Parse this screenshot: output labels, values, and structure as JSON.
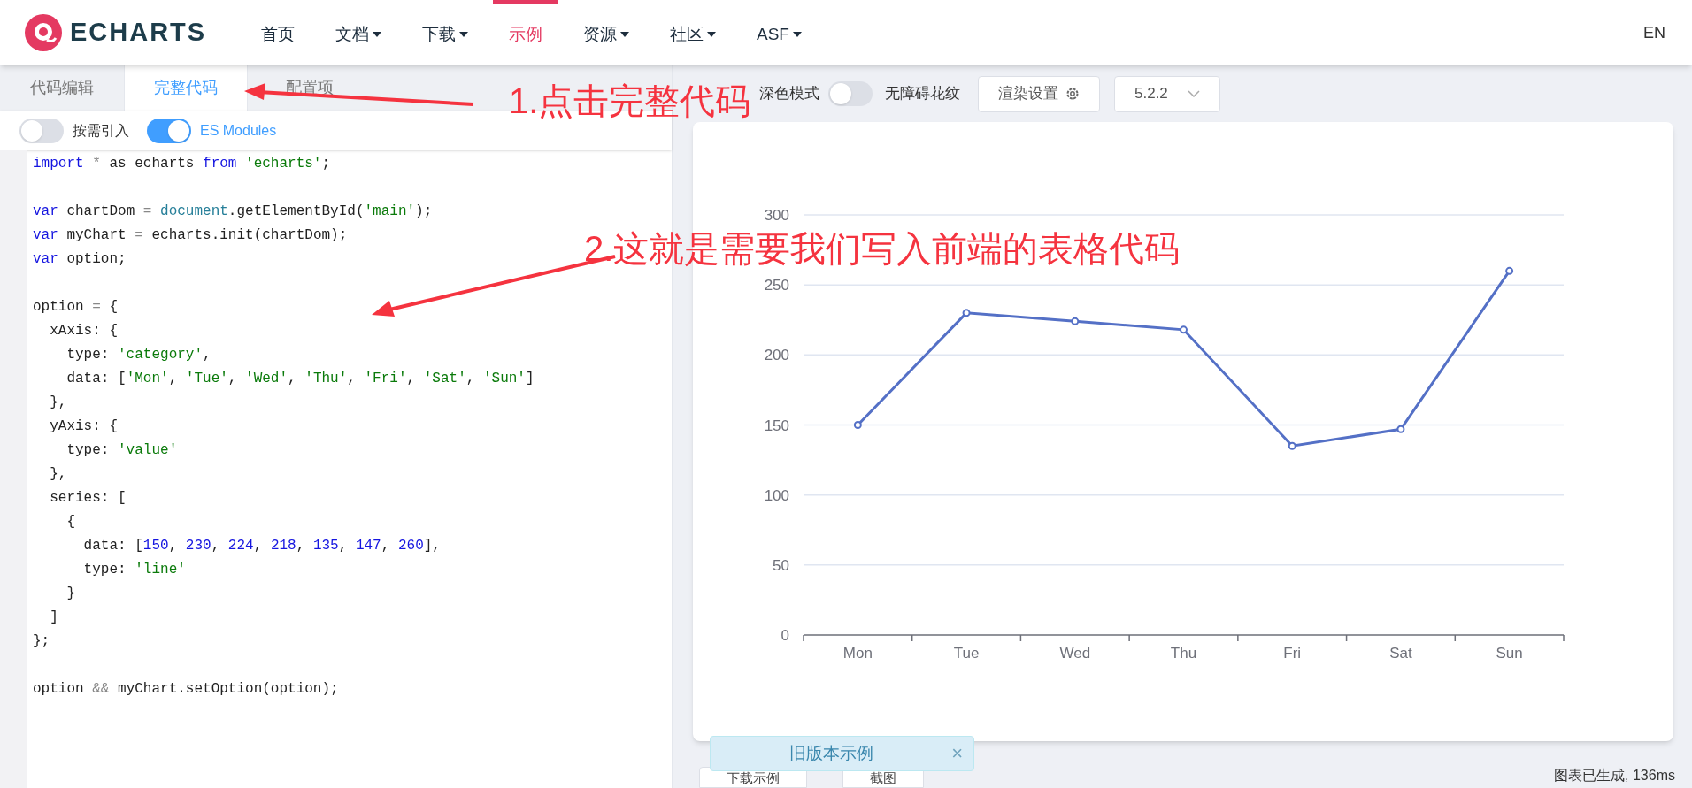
{
  "header": {
    "logo_text": "ECHARTS",
    "nav": [
      {
        "label": "首页",
        "has_menu": false,
        "selected": false
      },
      {
        "label": "文档",
        "has_menu": true,
        "selected": false
      },
      {
        "label": "下载",
        "has_menu": true,
        "selected": false
      },
      {
        "label": "示例",
        "has_menu": false,
        "selected": true
      },
      {
        "label": "资源",
        "has_menu": true,
        "selected": false
      },
      {
        "label": "社区",
        "has_menu": true,
        "selected": false
      },
      {
        "label": "ASF",
        "has_menu": true,
        "selected": false
      }
    ],
    "language": "EN"
  },
  "editor": {
    "tabs": [
      {
        "label": "代码编辑",
        "selected": false
      },
      {
        "label": "完整代码",
        "selected": true
      },
      {
        "label": "配置项",
        "selected": false
      }
    ],
    "toggles": [
      {
        "label": "按需引入",
        "on": false
      },
      {
        "label": "ES Modules",
        "on": true
      }
    ],
    "code_lines": [
      {
        "kind": "code",
        "tokens": [
          {
            "kind": "keyword",
            "text": "import"
          },
          {
            "kind": "operator",
            "text": " * "
          },
          {
            "kind": "plain",
            "text": "as echarts "
          },
          {
            "kind": "keyword",
            "text": "from"
          },
          {
            "kind": "string",
            "text": " 'echarts'"
          },
          {
            "kind": "plain",
            "text": ";"
          }
        ]
      },
      {
        "kind": "blank"
      },
      {
        "kind": "code",
        "tokens": [
          {
            "kind": "keyword",
            "text": "var"
          },
          {
            "kind": "plain",
            "text": " chartDom "
          },
          {
            "kind": "operator",
            "text": "="
          },
          {
            "kind": "builtin",
            "text": " document"
          },
          {
            "kind": "plain",
            "text": ".getElementById("
          },
          {
            "kind": "string",
            "text": "'main'"
          },
          {
            "kind": "plain",
            "text": ");"
          }
        ]
      },
      {
        "kind": "code",
        "tokens": [
          {
            "kind": "keyword",
            "text": "var"
          },
          {
            "kind": "plain",
            "text": " myChart "
          },
          {
            "kind": "operator",
            "text": "="
          },
          {
            "kind": "plain",
            "text": " echarts.init(chartDom);"
          }
        ]
      },
      {
        "kind": "code",
        "tokens": [
          {
            "kind": "keyword",
            "text": "var"
          },
          {
            "kind": "plain",
            "text": " option;"
          }
        ]
      },
      {
        "kind": "blank"
      },
      {
        "kind": "code",
        "tokens": [
          {
            "kind": "plain",
            "text": "option "
          },
          {
            "kind": "operator",
            "text": "="
          },
          {
            "kind": "plain",
            "text": " {"
          }
        ]
      },
      {
        "kind": "code",
        "tokens": [
          {
            "kind": "plain",
            "text": "  xAxis: {"
          }
        ]
      },
      {
        "kind": "code",
        "tokens": [
          {
            "kind": "plain",
            "text": "    type: "
          },
          {
            "kind": "string",
            "text": "'category'"
          },
          {
            "kind": "plain",
            "text": ","
          }
        ]
      },
      {
        "kind": "code",
        "tokens": [
          {
            "kind": "plain",
            "text": "    data: ["
          },
          {
            "kind": "string",
            "text": "'Mon'"
          },
          {
            "kind": "plain",
            "text": ", "
          },
          {
            "kind": "string",
            "text": "'Tue'"
          },
          {
            "kind": "plain",
            "text": ", "
          },
          {
            "kind": "string",
            "text": "'Wed'"
          },
          {
            "kind": "plain",
            "text": ", "
          },
          {
            "kind": "string",
            "text": "'Thu'"
          },
          {
            "kind": "plain",
            "text": ", "
          },
          {
            "kind": "string",
            "text": "'Fri'"
          },
          {
            "kind": "plain",
            "text": ", "
          },
          {
            "kind": "string",
            "text": "'Sat'"
          },
          {
            "kind": "plain",
            "text": ", "
          },
          {
            "kind": "string",
            "text": "'Sun'"
          },
          {
            "kind": "plain",
            "text": "]"
          }
        ]
      },
      {
        "kind": "code",
        "tokens": [
          {
            "kind": "plain",
            "text": "  },"
          }
        ]
      },
      {
        "kind": "code",
        "tokens": [
          {
            "kind": "plain",
            "text": "  yAxis: {"
          }
        ]
      },
      {
        "kind": "code",
        "tokens": [
          {
            "kind": "plain",
            "text": "    type: "
          },
          {
            "kind": "string",
            "text": "'value'"
          }
        ]
      },
      {
        "kind": "code",
        "tokens": [
          {
            "kind": "plain",
            "text": "  },"
          }
        ]
      },
      {
        "kind": "code",
        "tokens": [
          {
            "kind": "plain",
            "text": "  series: ["
          }
        ]
      },
      {
        "kind": "code",
        "tokens": [
          {
            "kind": "plain",
            "text": "    {"
          }
        ]
      },
      {
        "kind": "code",
        "tokens": [
          {
            "kind": "plain",
            "text": "      data: ["
          },
          {
            "kind": "number",
            "text": "150"
          },
          {
            "kind": "plain",
            "text": ", "
          },
          {
            "kind": "number",
            "text": "230"
          },
          {
            "kind": "plain",
            "text": ", "
          },
          {
            "kind": "number",
            "text": "224"
          },
          {
            "kind": "plain",
            "text": ", "
          },
          {
            "kind": "number",
            "text": "218"
          },
          {
            "kind": "plain",
            "text": ", "
          },
          {
            "kind": "number",
            "text": "135"
          },
          {
            "kind": "plain",
            "text": ", "
          },
          {
            "kind": "number",
            "text": "147"
          },
          {
            "kind": "plain",
            "text": ", "
          },
          {
            "kind": "number",
            "text": "260"
          },
          {
            "kind": "plain",
            "text": "],"
          }
        ]
      },
      {
        "kind": "code",
        "tokens": [
          {
            "kind": "plain",
            "text": "      type: "
          },
          {
            "kind": "string",
            "text": "'line'"
          }
        ]
      },
      {
        "kind": "code",
        "tokens": [
          {
            "kind": "plain",
            "text": "    }"
          }
        ]
      },
      {
        "kind": "code",
        "tokens": [
          {
            "kind": "plain",
            "text": "  ]"
          }
        ]
      },
      {
        "kind": "code",
        "tokens": [
          {
            "kind": "plain",
            "text": "};"
          }
        ]
      },
      {
        "kind": "blank"
      },
      {
        "kind": "code",
        "tokens": [
          {
            "kind": "plain",
            "text": "option "
          },
          {
            "kind": "operator",
            "text": "&&"
          },
          {
            "kind": "plain",
            "text": " myChart.setOption(option);"
          }
        ]
      }
    ]
  },
  "toolbar": {
    "dark_mode": {
      "label": "深色模式",
      "on": false
    },
    "pattern_label": "无障碍花纹",
    "render_button": "渲染设置",
    "version": "5.2.2"
  },
  "chart": {
    "chart_data": {
      "type": "line",
      "categories": [
        "Mon",
        "Tue",
        "Wed",
        "Thu",
        "Fri",
        "Sat",
        "Sun"
      ],
      "grid": true,
      "series": [
        {
          "color": "#5470c6",
          "marker": "circle",
          "values": [
            150,
            230,
            224,
            218,
            135,
            147,
            260
          ]
        }
      ],
      "ylim": [
        0,
        300
      ],
      "yticks": [
        0,
        50,
        100,
        150,
        200,
        250,
        300
      ]
    }
  },
  "footer": {
    "buttons": [
      "下载示例",
      "截图"
    ],
    "status": "图表已生成, 136ms"
  },
  "toast": {
    "text": "旧版本示例",
    "close": "×"
  },
  "annotations": [
    {
      "text": "1.点击完整代码"
    },
    {
      "text": "2.这就是需要我们写入前端的表格代码"
    }
  ]
}
